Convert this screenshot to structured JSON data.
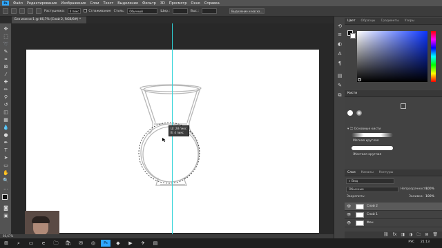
{
  "menu": {
    "logo": "Ps",
    "items": [
      "Файл",
      "Редактирование",
      "Изображение",
      "Слои",
      "Текст",
      "Выделение",
      "Фильтр",
      "3D",
      "Просмотр",
      "Окно",
      "Справка"
    ]
  },
  "options": {
    "feather_label": "Растушевка:",
    "feather_value": "0 пикс",
    "antialias_label": "Сглаживание",
    "style_label": "Стиль:",
    "style_value": "Обычный",
    "width_label": "Шир.:",
    "height_label": "Выс.:",
    "select_mask_label": "Выделение и маска..."
  },
  "document": {
    "tab_title": "Без имени-1 @ 66,7% (Слой 2, RGB/8#) *"
  },
  "tooltip": {
    "line1": "Ш: 28 пикс",
    "line2": "В: 4 пикс"
  },
  "status": {
    "zoom": "66,67%"
  },
  "panels": {
    "color_tabs": [
      "Цвет",
      "Образцы",
      "Градиенты",
      "Узоры"
    ],
    "brush_tabs": [
      "Кисти"
    ],
    "brush_group": "Основные кисти",
    "brush1": "Мягкая круглая",
    "brush2": "Жесткая круглая",
    "layer_tabs": [
      "Слои",
      "Каналы",
      "Контуры"
    ],
    "filter_label": "Вид",
    "blend_mode": "Обычные",
    "opacity_label": "Непрозрачность:",
    "opacity_value": "100%",
    "lock_label": "Закрепить:",
    "fill_label": "Заливка:",
    "fill_value": "100%",
    "layers": [
      {
        "name": "Слой 2",
        "selected": true
      },
      {
        "name": "Слой 1",
        "selected": false
      },
      {
        "name": "Фон",
        "selected": false
      }
    ]
  },
  "taskbar": {
    "lang": "РУС",
    "time": "21:13"
  },
  "colors": {
    "guide": "#2fd3d8",
    "ps_blue": "#31a8ff"
  }
}
